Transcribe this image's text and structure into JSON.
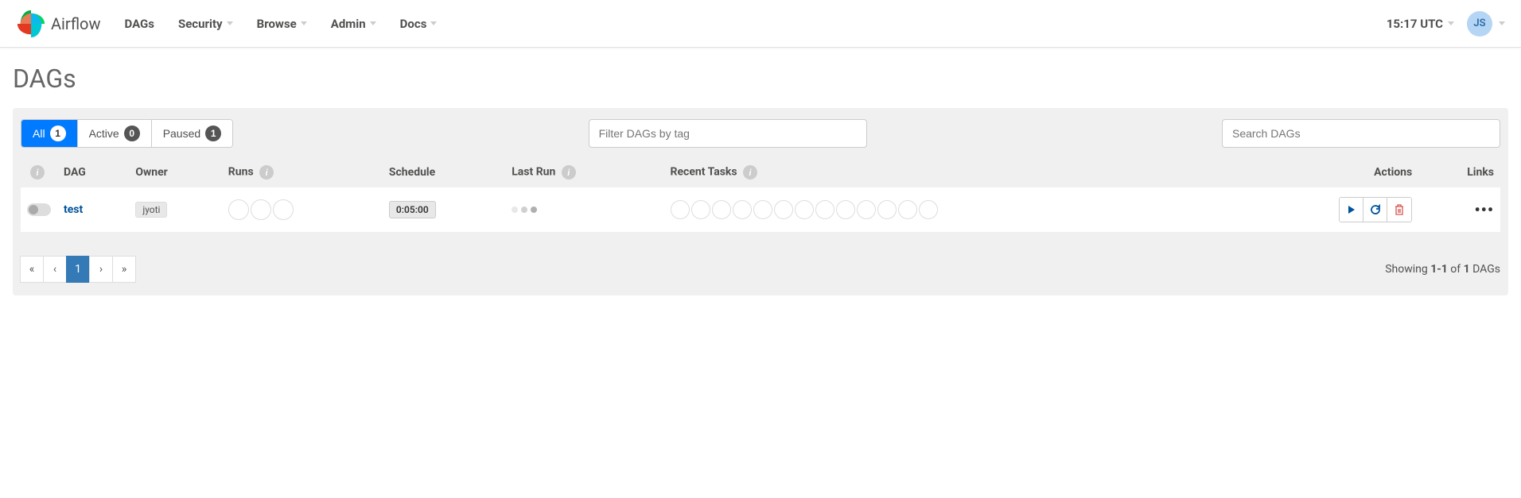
{
  "brand": "Airflow",
  "nav": {
    "dags": "DAGs",
    "security": "Security",
    "browse": "Browse",
    "admin": "Admin",
    "docs": "Docs"
  },
  "time": "15:17 UTC",
  "user_initials": "JS",
  "page_title": "DAGs",
  "filters": {
    "all": {
      "label": "All",
      "count": "1"
    },
    "active": {
      "label": "Active",
      "count": "0"
    },
    "paused": {
      "label": "Paused",
      "count": "1"
    }
  },
  "filter_placeholder": "Filter DAGs by tag",
  "search_placeholder": "Search DAGs",
  "columns": {
    "dag": "DAG",
    "owner": "Owner",
    "runs": "Runs",
    "schedule": "Schedule",
    "last_run": "Last Run",
    "recent_tasks": "Recent Tasks",
    "actions": "Actions",
    "links": "Links"
  },
  "rows": [
    {
      "name": "test",
      "owner": "jyoti",
      "schedule": "0:05:00"
    }
  ],
  "pagination": {
    "first": "«",
    "prev": "‹",
    "pages": [
      "1"
    ],
    "next": "›",
    "last": "»"
  },
  "showing": {
    "prefix": "Showing ",
    "range": "1-1",
    "mid": " of ",
    "total": "1",
    "suffix": " DAGs"
  }
}
